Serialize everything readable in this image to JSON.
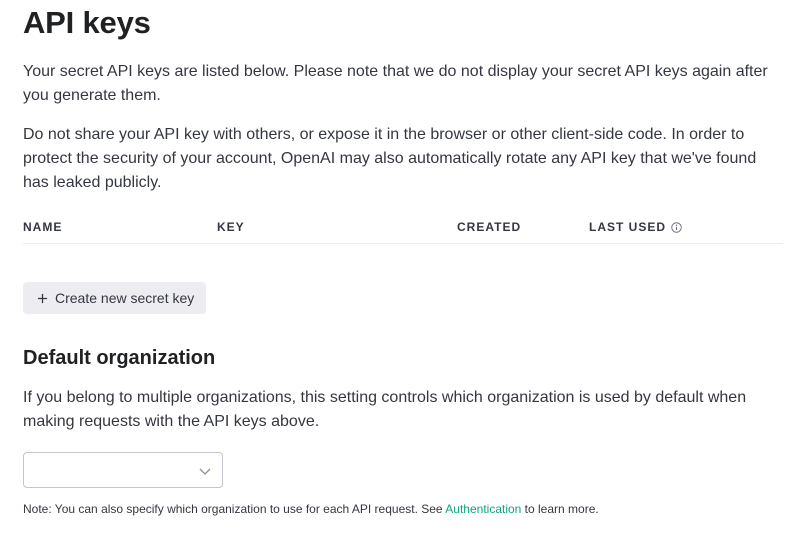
{
  "page": {
    "title": "API keys",
    "intro": "Your secret API keys are listed below. Please note that we do not display your secret API keys again after you generate them.",
    "warning": "Do not share your API key with others, or expose it in the browser or other client-side code. In order to protect the security of your account, OpenAI may also automatically rotate any API key that we've found has leaked publicly."
  },
  "keys_table": {
    "columns": {
      "name": "NAME",
      "key": "KEY",
      "created": "CREATED",
      "last_used": "LAST USED"
    },
    "info_icon": "info-circle-icon",
    "rows": []
  },
  "create_button": {
    "icon": "plus-icon",
    "label": "Create new secret key"
  },
  "default_org": {
    "heading": "Default organization",
    "description": "If you belong to multiple organizations, this setting controls which organization is used by default when making requests with the API keys above.",
    "select_value": "",
    "select_icon": "chevron-down-icon",
    "note_prefix": "Note: You can also specify which organization to use for each API request. See ",
    "note_link": "Authentication",
    "note_suffix": " to learn more."
  },
  "colors": {
    "text": "#353740",
    "heading": "#202123",
    "button_bg": "#ececf1",
    "border": "#c5c5d2",
    "link": "#10a37f"
  }
}
